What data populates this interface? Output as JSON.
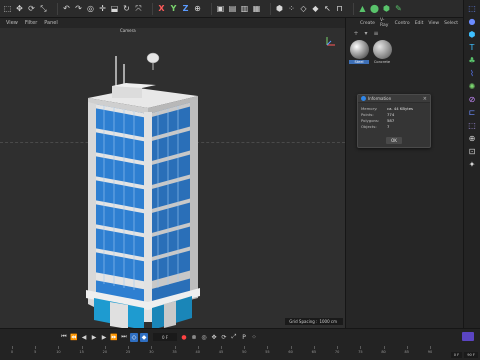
{
  "viewport": {
    "menu": [
      "View",
      "Filter",
      "Panel"
    ],
    "camera_label": "Camera",
    "grid_spacing_label": "Grid Spacing :",
    "grid_spacing_value": "1000 cm"
  },
  "right_panel": {
    "menu": [
      "Create",
      "V-Ray",
      "Contro",
      "Edit",
      "View",
      "Select"
    ],
    "materials": [
      {
        "name": "Steel",
        "selected": true
      },
      {
        "name": "Concrete"
      }
    ]
  },
  "info_dialog": {
    "title": "Information",
    "rows": [
      {
        "key": "Memory:",
        "value": "ca. 44 KBytes"
      },
      {
        "key": "Points:",
        "value": "774"
      },
      {
        "key": "Polygons:",
        "value": "587"
      },
      {
        "key": "Objects:",
        "value": "7"
      }
    ],
    "ok_label": "OK"
  },
  "timeline": {
    "current_frame_field": "0 F",
    "ruler_numbers": [
      "0",
      "5",
      "10",
      "15",
      "20",
      "25",
      "30",
      "35",
      "40",
      "45",
      "50",
      "55",
      "60",
      "65",
      "70",
      "75",
      "80",
      "85",
      "90"
    ],
    "start_frame": "0 F",
    "end_frame": "90 F"
  },
  "colors": {
    "accent": "#3d6fb6",
    "building_blue": "#2f7fd6",
    "record_red": "#ff4242",
    "tool_green": "#59c36b"
  }
}
